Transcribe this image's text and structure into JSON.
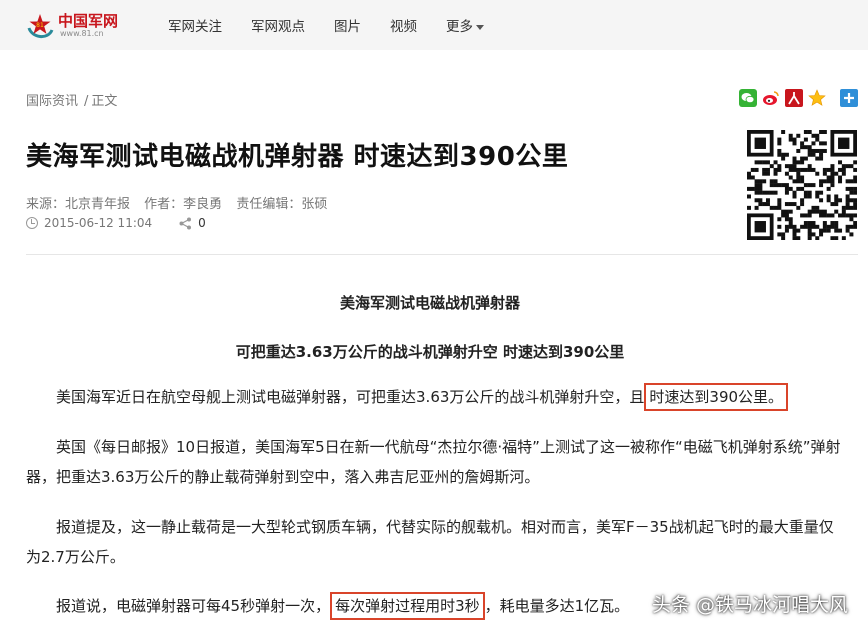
{
  "header": {
    "logo": {
      "name": "中国军网",
      "url": "www.81.cn"
    },
    "nav": [
      {
        "label": "军网关注"
      },
      {
        "label": "军网观点"
      },
      {
        "label": "图片"
      },
      {
        "label": "视频"
      },
      {
        "label": "更多"
      }
    ]
  },
  "breadcrumb": {
    "section": "国际资讯",
    "current": "正文"
  },
  "share_icons": [
    "wechat-icon",
    "weibo-icon",
    "renren-icon",
    "qzone-icon",
    "more-share-icon"
  ],
  "article": {
    "title": "美海军测试电磁战机弹射器 时速达到390公里",
    "source": "来源：北京青年报",
    "author": "作者：李良勇",
    "editor": "责任编辑：张硕",
    "datetime": "2015-06-12 11:04",
    "share_count": "0",
    "subtitle1": "美海军测试电磁战机弹射器",
    "subtitle2": "可把重达3.63万公斤的战斗机弹射升空 时速达到390公里",
    "p1_before": "美国海军近日在航空母舰上测试电磁弹射器，可把重达3.63万公斤的战斗机弹射升空，且",
    "p1_highlight": "时速达到390公里。",
    "p2": "英国《每日邮报》10日报道，美国海军5日在新一代航母“杰拉尔德·福特”上测试了这一被称作“电磁飞机弹射系统”弹射器，把重达3.63万公斤的静止载荷弹射到空中，落入弗吉尼亚州的詹姆斯河。",
    "p3": "报道提及，这一静止载荷是一大型轮式钢质车辆，代替实际的舰载机。相对而言，美军F－35战机起飞时的最大重量仅为2.7万公斤。",
    "p4_before": "报道说，电磁弹射器可每45秒弹射一次，",
    "p4_highlight": "每次弹射过程用时3秒",
    "p4_after": "，耗电量多达1亿瓦。"
  },
  "watermark": "头条 @铁马冰河唱大风",
  "colors": {
    "brand_red": "#c8161d",
    "highlight_border": "#d9442a",
    "topbar_bg": "#f5f5f5"
  }
}
